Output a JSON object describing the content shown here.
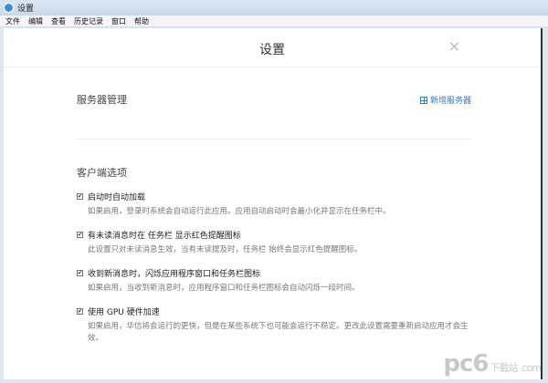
{
  "window": {
    "title": "设置"
  },
  "menu": [
    "文件",
    "编辑",
    "查看",
    "历史记录",
    "窗口",
    "帮助"
  ],
  "header": {
    "title": "设置",
    "close": "×"
  },
  "server": {
    "title": "服务器管理",
    "add_label": "新增服务器"
  },
  "client": {
    "title": "客户端选项",
    "options": [
      {
        "label": "启动时自动加载",
        "desc": "如果启用，登录时系统会自动运行此应用。应用自动启动时会最小化并显示在任务栏中。",
        "checked": true
      },
      {
        "label": "有未读消息时在 任务栏 显示红色提醒图标",
        "desc": "此设置只对未读消息生效，当有未读提及时，任务栏 始终会显示红色提醒图标。",
        "checked": true
      },
      {
        "label": "收到新消息时，闪烁应用程序窗口和任务栏图标",
        "desc": "如果启用，当收到新消息时，应用程序窗口和任务栏图标会自动闪烁一段时间。",
        "checked": true
      },
      {
        "label": "使用 GPU 硬件加速",
        "desc": "如果启用，华信将会运行的更快，但是在某些系统下也可能会运行不稳定。更改此设置需要重新启动应用才会生效。",
        "checked": true
      }
    ]
  },
  "watermark": {
    "text": "pc6",
    "sub": "下载站 .com"
  }
}
